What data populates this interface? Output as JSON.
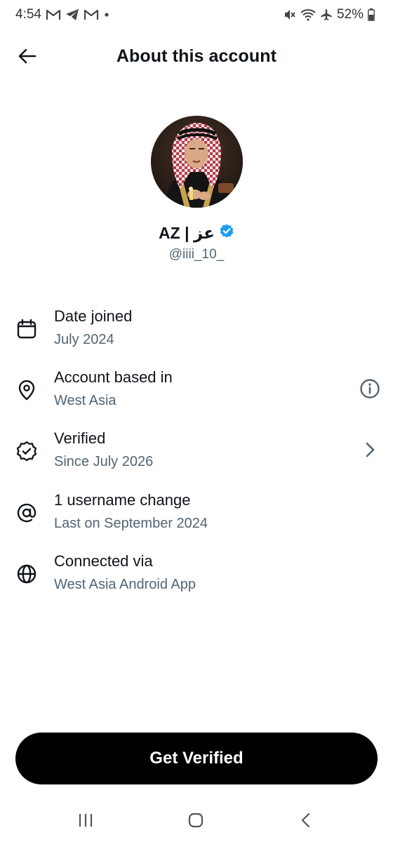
{
  "status_bar": {
    "time": "4:54",
    "battery": "52%",
    "left_icons": [
      "gmail-icon",
      "telegram-icon",
      "gmail-icon",
      "notification-dot"
    ],
    "right_icons": [
      "mute-icon",
      "wifi-icon",
      "airplane-icon",
      "battery-icon"
    ]
  },
  "header": {
    "title": "About this account"
  },
  "profile": {
    "display_name": "AZ | عز",
    "handle": "@iiii_10_",
    "verified": true
  },
  "details": [
    {
      "icon": "calendar-icon",
      "title": "Date joined",
      "subtitle": "July 2024"
    },
    {
      "icon": "location-pin-icon",
      "title": "Account based in",
      "subtitle": "West Asia",
      "trail": "info-icon"
    },
    {
      "icon": "verified-badge-icon",
      "title": "Verified",
      "subtitle": "Since July 2026",
      "trail": "chevron-right-icon"
    },
    {
      "icon": "at-sign-icon",
      "title": "1 username change",
      "subtitle": "Last on September 2024"
    },
    {
      "icon": "globe-icon",
      "title": "Connected via",
      "subtitle": "West Asia Android App"
    }
  ],
  "cta": {
    "label": "Get Verified"
  },
  "colors": {
    "primary_text": "#0f1419",
    "secondary_text": "#536471",
    "verified_blue": "#1d9bf0",
    "button_bg": "#000000"
  }
}
